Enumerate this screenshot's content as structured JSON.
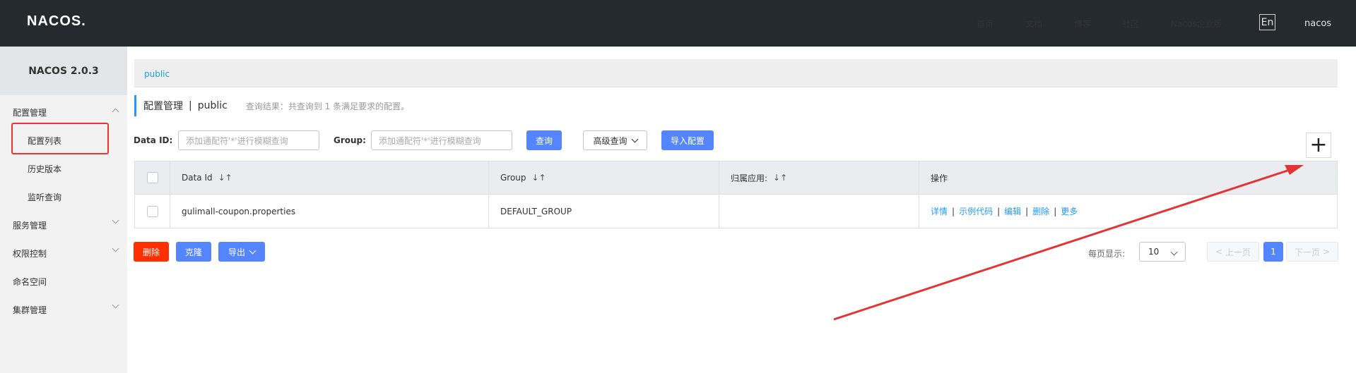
{
  "topbar": {
    "logo": "NACOS.",
    "nav": [
      "首页",
      "文档",
      "博客",
      "社区",
      "Nacos企业版"
    ],
    "lang": "En",
    "user": "nacos"
  },
  "sidebar": {
    "version": "NACOS 2.0.3",
    "groups": [
      {
        "label": "配置管理",
        "expanded": true,
        "items": [
          "配置列表",
          "历史版本",
          "监听查询"
        ]
      },
      {
        "label": "服务管理",
        "expanded": false
      },
      {
        "label": "权限控制",
        "expanded": false
      },
      {
        "label": "命名空间"
      },
      {
        "label": "集群管理",
        "expanded": false
      }
    ],
    "selected": "配置列表"
  },
  "breadcrumb": "public",
  "header": {
    "title": "配置管理",
    "separator": "|",
    "namespace": "public",
    "hint": "查询结果：共查询到 1 条满足要求的配置。"
  },
  "search": {
    "dataid_label": "Data ID:",
    "dataid_placeholder": "添加通配符'*'进行模糊查询",
    "group_label": "Group:",
    "group_placeholder": "添加通配符'*'进行模糊查询",
    "query_btn": "查询",
    "advanced_btn": "高级查询",
    "import_btn": "导入配置",
    "add_btn": "+"
  },
  "table": {
    "headers": [
      "Data Id",
      "Group",
      "归属应用:",
      "操作"
    ],
    "sort_icon": "↓↑",
    "rows": [
      {
        "dataid": "gulimall-coupon.properties",
        "group": "DEFAULT_GROUP",
        "app": "",
        "ops": [
          "详情",
          "示例代码",
          "编辑",
          "删除",
          "更多"
        ]
      }
    ]
  },
  "bulk": {
    "delete": "删除",
    "clone": "克隆",
    "export": "导出"
  },
  "pager": {
    "per_page_label": "每页显示:",
    "per_page": "10",
    "prev": "上一页",
    "current": "1",
    "next": "下一页"
  },
  "colors": {
    "topbar": "#252a2f",
    "primary": "#5584ff",
    "danger": "#ff3000",
    "link": "#209bfa",
    "annotation": "#e33333"
  }
}
